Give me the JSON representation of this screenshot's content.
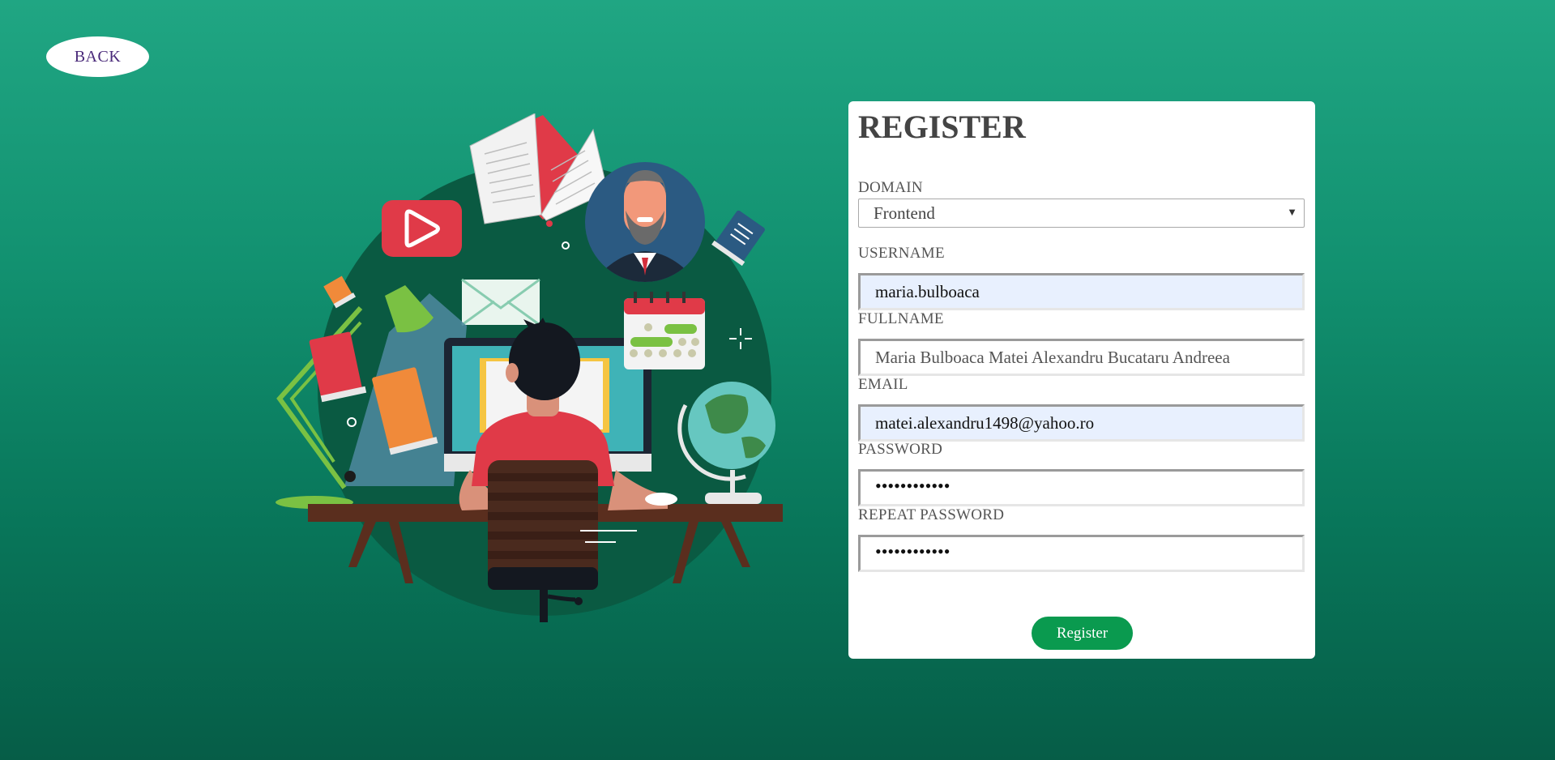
{
  "nav": {
    "back_label": "BACK"
  },
  "form": {
    "title": "REGISTER",
    "domain": {
      "label": "DOMAIN",
      "selected": "Frontend"
    },
    "username": {
      "label": "USERNAME",
      "value": "maria.bulboaca"
    },
    "fullname": {
      "label": "FULLNAME",
      "value": "Maria Bulboaca Matei Alexandru Bucataru Andreea"
    },
    "email": {
      "label": "EMAIL",
      "value": "matei.alexandru1498@yahoo.ro"
    },
    "password": {
      "label": "PASSWORD",
      "value": "••••••••••••"
    },
    "repeat_password": {
      "label": "REPEAT PASSWORD",
      "value": "••••••••••••"
    },
    "submit_label": "Register"
  },
  "colors": {
    "background_top": "#20a683",
    "background_bottom": "#065d47",
    "panel": "#ffffff",
    "submit_button": "#0a9a4f",
    "autofill": "#e8f0fe",
    "back_text": "#4a2a7a"
  },
  "illustration": {
    "description_icon": "student-at-desk-illustration"
  }
}
